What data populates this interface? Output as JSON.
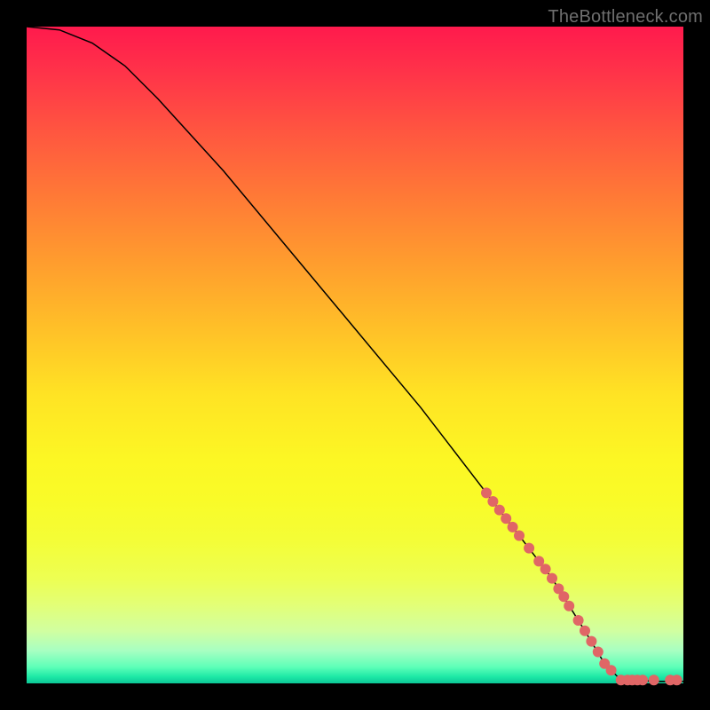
{
  "watermark": "TheBottleneck.com",
  "chart_data": {
    "type": "line",
    "title": "",
    "xlabel": "",
    "ylabel": "",
    "xlim": [
      0,
      100
    ],
    "ylim": [
      0,
      100
    ],
    "curve": [
      {
        "x": 0,
        "y": 100
      },
      {
        "x": 5,
        "y": 99.5
      },
      {
        "x": 10,
        "y": 97.5
      },
      {
        "x": 15,
        "y": 94
      },
      {
        "x": 20,
        "y": 89
      },
      {
        "x": 30,
        "y": 78
      },
      {
        "x": 40,
        "y": 66
      },
      {
        "x": 50,
        "y": 54
      },
      {
        "x": 60,
        "y": 42
      },
      {
        "x": 70,
        "y": 29
      },
      {
        "x": 80,
        "y": 16
      },
      {
        "x": 85,
        "y": 8
      },
      {
        "x": 88,
        "y": 3
      },
      {
        "x": 90,
        "y": 1
      },
      {
        "x": 92,
        "y": 0.5
      },
      {
        "x": 96,
        "y": 0.3
      },
      {
        "x": 100,
        "y": 0.3
      }
    ],
    "marker_points": [
      {
        "x": 70.0,
        "y": 29.0
      },
      {
        "x": 71.0,
        "y": 27.7
      },
      {
        "x": 72.0,
        "y": 26.4
      },
      {
        "x": 73.0,
        "y": 25.1
      },
      {
        "x": 74.0,
        "y": 23.8
      },
      {
        "x": 75.0,
        "y": 22.5
      },
      {
        "x": 76.5,
        "y": 20.6
      },
      {
        "x": 78.0,
        "y": 18.6
      },
      {
        "x": 79.0,
        "y": 17.4
      },
      {
        "x": 80.0,
        "y": 16.0
      },
      {
        "x": 81.0,
        "y": 14.4
      },
      {
        "x": 81.8,
        "y": 13.2
      },
      {
        "x": 82.6,
        "y": 11.8
      },
      {
        "x": 84.0,
        "y": 9.6
      },
      {
        "x": 85.0,
        "y": 8.0
      },
      {
        "x": 86.0,
        "y": 6.4
      },
      {
        "x": 87.0,
        "y": 4.8
      },
      {
        "x": 88.0,
        "y": 3.0
      },
      {
        "x": 89.0,
        "y": 2.0
      },
      {
        "x": 90.5,
        "y": 0.5
      },
      {
        "x": 91.5,
        "y": 0.5
      },
      {
        "x": 92.2,
        "y": 0.5
      },
      {
        "x": 93.0,
        "y": 0.5
      },
      {
        "x": 93.8,
        "y": 0.5
      },
      {
        "x": 95.5,
        "y": 0.5
      },
      {
        "x": 98.0,
        "y": 0.5
      },
      {
        "x": 99.0,
        "y": 0.5
      }
    ],
    "marker_color": "#e06666",
    "marker_radius": 6
  }
}
